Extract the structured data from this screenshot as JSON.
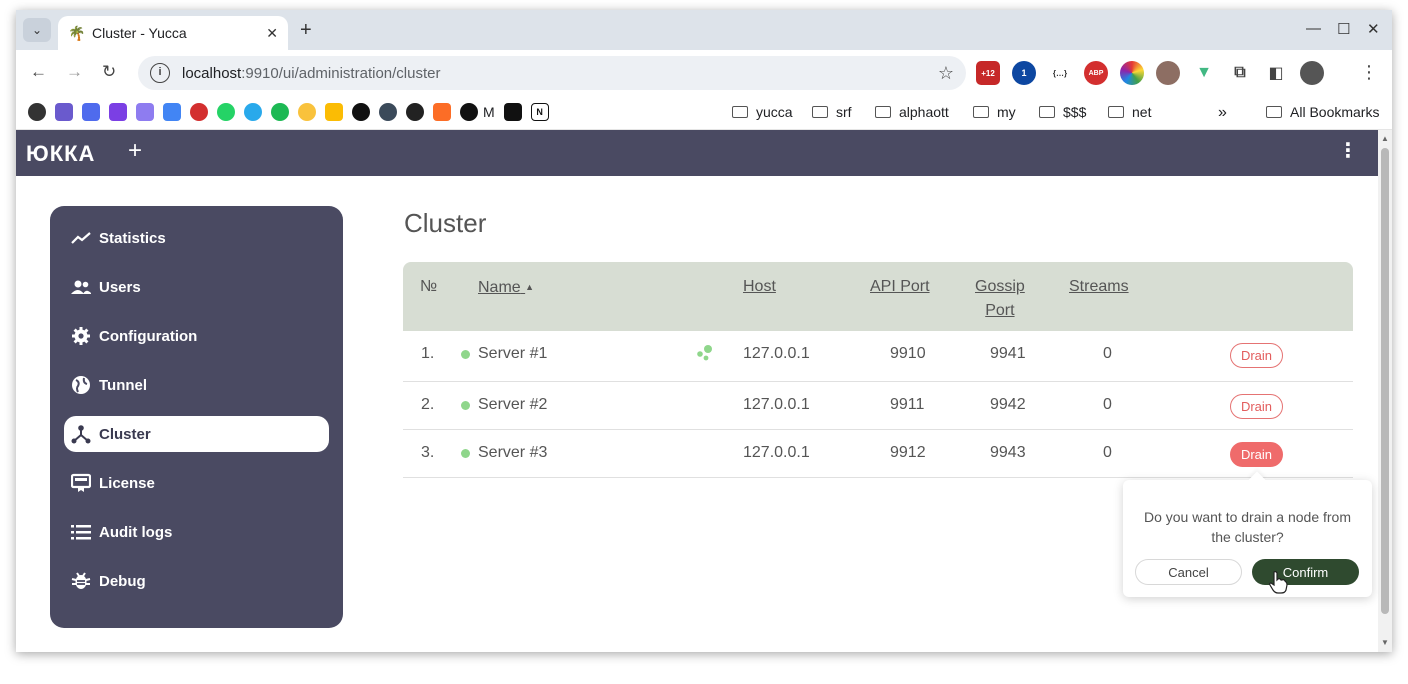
{
  "browser": {
    "tab_title": "Cluster - Yucca",
    "url_host": "localhost",
    "url_path": ":9910/ui/administration/cluster",
    "bookmark_folders": [
      "yucca",
      "srf",
      "alphaott",
      "my",
      "$$$",
      "net"
    ],
    "bookmark_text_m": "M",
    "all_bookmarks": "All Bookmarks",
    "badge": "+12",
    "ext_abp": "ABP",
    "ext_json": "{…}",
    "more_bookmarks": "»"
  },
  "app": {
    "logo": "ЮККА",
    "colors": {
      "header": "#4a4a62",
      "accent_green": "#2f4a2f",
      "danger": "#ef6b6b",
      "table_head": "#d7ddd3"
    }
  },
  "sidebar": {
    "items": [
      {
        "label": "Statistics",
        "icon": "chart-line-icon"
      },
      {
        "label": "Users",
        "icon": "users-icon"
      },
      {
        "label": "Configuration",
        "icon": "gear-icon"
      },
      {
        "label": "Tunnel",
        "icon": "globe-icon"
      },
      {
        "label": "Cluster",
        "icon": "cluster-icon",
        "active": true
      },
      {
        "label": "License",
        "icon": "license-icon"
      },
      {
        "label": "Audit logs",
        "icon": "list-icon"
      },
      {
        "label": "Debug",
        "icon": "bug-icon"
      }
    ]
  },
  "main": {
    "title": "Cluster",
    "columns": {
      "num": "№",
      "name": "Name",
      "sort": "▲",
      "host": "Host",
      "api_port": "API Port",
      "gossip_port_1": "Gossip",
      "gossip_port_2": "Port",
      "streams": "Streams"
    },
    "rows": [
      {
        "num": "1.",
        "name": "Server #1",
        "host": "127.0.0.1",
        "api_port": "9910",
        "gossip_port": "9941",
        "streams": "0",
        "action": "Drain",
        "leader": true
      },
      {
        "num": "2.",
        "name": "Server #2",
        "host": "127.0.0.1",
        "api_port": "9911",
        "gossip_port": "9942",
        "streams": "0",
        "action": "Drain"
      },
      {
        "num": "3.",
        "name": "Server #3",
        "host": "127.0.0.1",
        "api_port": "9912",
        "gossip_port": "9943",
        "streams": "0",
        "action": "Drain",
        "pressed": true
      }
    ]
  },
  "popconfirm": {
    "message": "Do you want to drain a node from the cluster?",
    "cancel": "Cancel",
    "confirm": "Confirm"
  }
}
